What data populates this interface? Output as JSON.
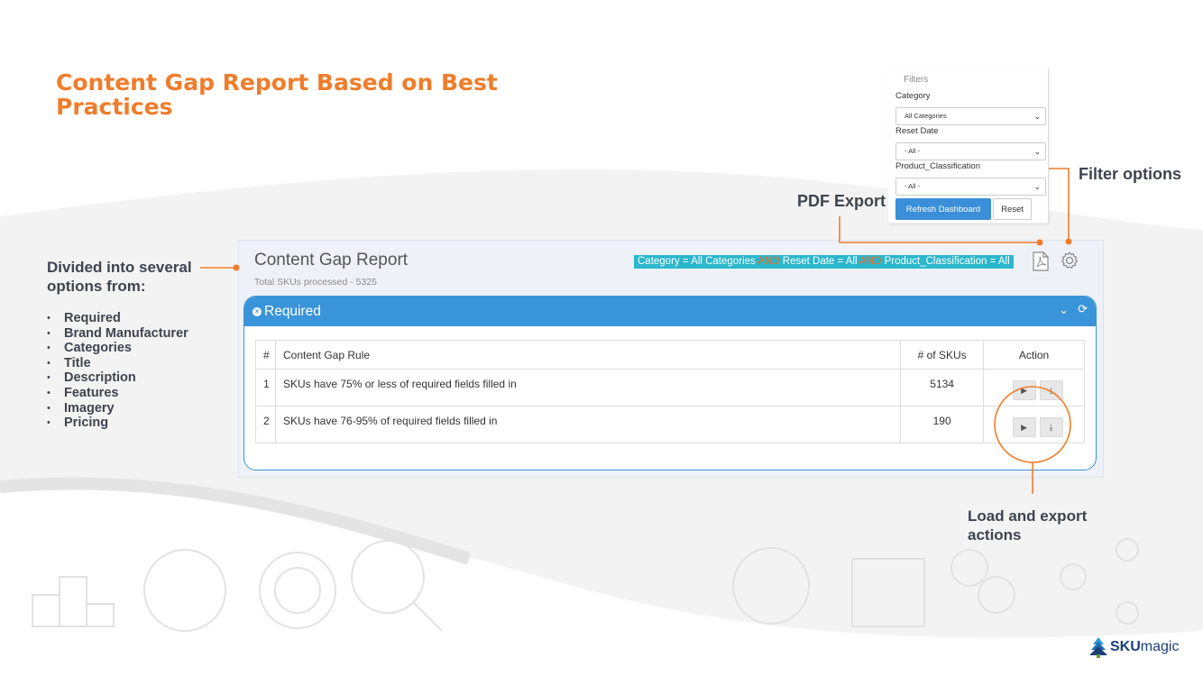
{
  "slide": {
    "title": "Content Gap Report Based on Best Practices"
  },
  "filters_panel": {
    "title": "Filters",
    "category_label": "Category",
    "category_value": "All Categories",
    "reset_date_label": "Reset Date",
    "reset_date_value": "- All -",
    "product_class_label": "Product_Classification",
    "product_class_value": "- All -",
    "refresh_button": "Refresh Dashboard",
    "reset_button": "Reset"
  },
  "callouts": {
    "filter_options": "Filter options",
    "pdf_export": "PDF Export",
    "divided_line1": "Divided into several",
    "divided_line2": "options from:",
    "load_line1": "Load and export",
    "load_line2": "actions",
    "bullets": [
      "Required",
      "Brand Manufacturer",
      "Categories",
      "Title",
      "Description",
      "Features",
      "Imagery",
      "Pricing"
    ]
  },
  "report": {
    "title": "Content Gap Report",
    "subtitle": "Total SKUs processed - 5325",
    "filter_summary": {
      "part1": "Category = All Categories ",
      "and1": "AND",
      "part2": " Reset Date = All ",
      "and2": "AND",
      "part3": " Product_Classification = All"
    },
    "section_label": "Required",
    "table": {
      "headers": [
        "#",
        "Content Gap Rule",
        "# of SKUs",
        "Action"
      ],
      "rows": [
        {
          "num": "1",
          "rule": "SKUs have 75% or less of required fields filled in",
          "count": "5134"
        },
        {
          "num": "2",
          "rule": "SKUs have 76-95% of required fields filled in",
          "count": "190"
        }
      ]
    }
  },
  "logo": {
    "brand_bold": "SKU",
    "brand_rest": "magic"
  },
  "colors": {
    "accent_orange": "#ef7d2b",
    "panel_blue": "#3a94d9",
    "summary_teal": "#2bb7cc"
  }
}
